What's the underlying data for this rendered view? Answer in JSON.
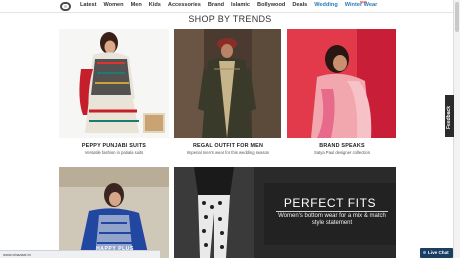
{
  "nav": {
    "items": [
      "Latest",
      "Women",
      "Men",
      "Kids",
      "Accessories",
      "Brand",
      "Islamic",
      "Bollywood",
      "Deals",
      "Wedding",
      "Winter Wear"
    ],
    "highlighted": [
      "Wedding",
      "Winter Wear"
    ],
    "badge": "NEW"
  },
  "section": {
    "heading": "SHOP BY TRENDS"
  },
  "cards": [
    {
      "title": "PEPPY PUNJABI SUITS",
      "subtitle": "Versatile fashion in patiala suits"
    },
    {
      "title": "REGAL OUTFIT FOR MEN",
      "subtitle": "Imperial men's wear for this wedding season"
    },
    {
      "title": "BRAND SPEAKS",
      "subtitle": "Satya Paul designer collection"
    }
  ],
  "promo": {
    "bottom_left_label": "HAPPY PLUS",
    "overlay_title": "PERFECT FITS",
    "overlay_sub": "Women's bottom wear for a mix & match style statement"
  },
  "feedback_label": "Feedback",
  "status_url": "www.cbazaar.in",
  "live_chat": "Live Chat",
  "colors": {
    "nav_highlight": "#2a7ab8",
    "live_chat_bg": "#1c3e63",
    "feedback_bg": "#2b2b2b"
  }
}
